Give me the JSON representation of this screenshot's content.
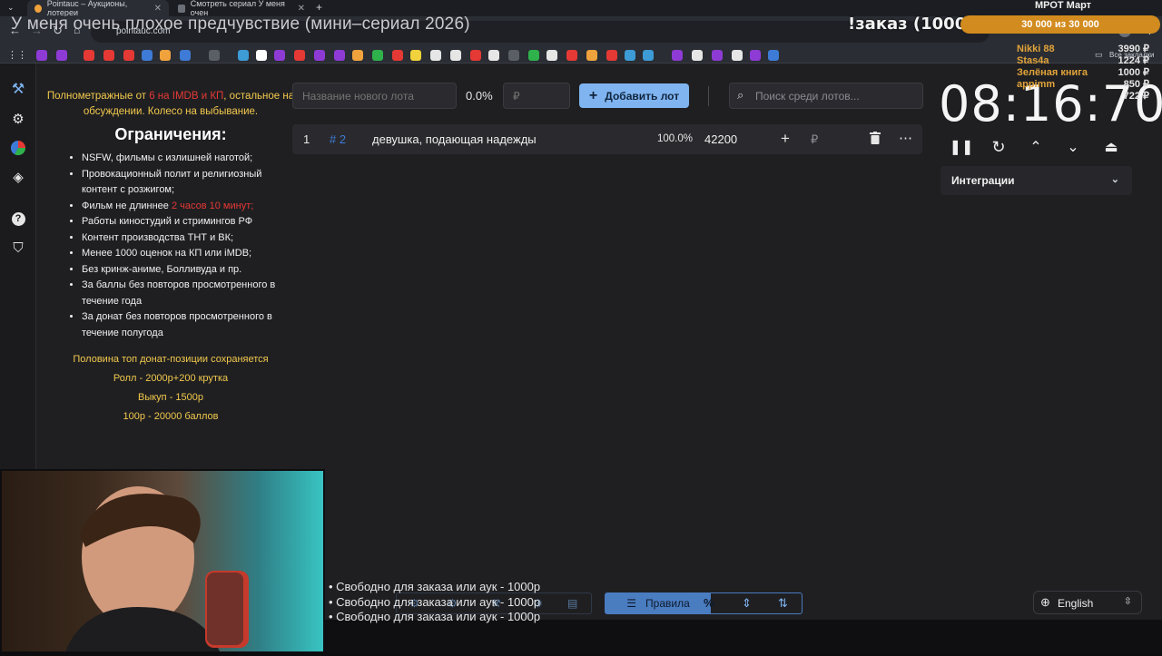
{
  "browser": {
    "tabs": [
      {
        "label": "Pointauc – Аукционы, лотереи",
        "active": true
      },
      {
        "label": "Смотреть сериал У меня очен",
        "active": false
      }
    ],
    "url": "pointauc.com",
    "all_bookmarks_label": "Все закладки"
  },
  "overlay": {
    "stream_title": "У меня очень плохое предчувствие (мини–сериал 2026)",
    "order_label": "!заказ (1000р)",
    "goal_title": "МРОТ Март",
    "goal_progress": "30 000  из 30 000",
    "goal_fraction": 1.0,
    "donors": [
      {
        "name": "Nikki 88",
        "amount": "3990 ₽"
      },
      {
        "name": "Stas4a",
        "amount": "1224 ₽"
      },
      {
        "name": "Зелёная книга",
        "amount": "1000 ₽"
      },
      {
        "name": "appimm",
        "amount": "850 ₽"
      },
      {
        "name": "",
        "amount": "722 ₽"
      }
    ],
    "ticker_lines": [
      "• Свободно для заказа или аук - 1000р",
      "• Свободно для заказа или аук - 1000р",
      "• Свободно для заказа или аук - 1000р"
    ]
  },
  "rules": {
    "top_line_prefix": "Полнометражные от ",
    "top_line_red": "6 на IMDB и КП",
    "top_line_suffix": ", остальное на обсуждении. Колесо на выбывание.",
    "heading": "Ограничения:",
    "items": [
      {
        "text": "NSFW, фильмы с излишней наготой;"
      },
      {
        "text": "Провокационный полит и религиозный контент с розжигом;"
      },
      {
        "text": "Фильм не длиннее ",
        "red": "2 часов 10 минут;"
      },
      {
        "text": "Работы киностудий и стримингов РФ"
      },
      {
        "text": "Контент производства ТНТ и ВК;"
      },
      {
        "text": "Менее 1000 оценок на КП или iMDB;"
      },
      {
        "text": "Без кринж-аниме, Болливуда и пр."
      },
      {
        "text": "За баллы без повторов просмотренного в течение года"
      },
      {
        "text": "За донат без повторов просмотренного в течение полугода"
      }
    ],
    "footer": [
      "Половина топ донат-позиции сохраняется",
      "Ролл - 2000р+200 крутка",
      "Выкуп - 1500р",
      "100р - 20000 баллов"
    ]
  },
  "lot_form": {
    "name_placeholder": "Название нового лота",
    "percent": "0.0%",
    "amount_placeholder": "₽",
    "add_button": "Добавить лот",
    "search_placeholder": "Поиск среди лотов..."
  },
  "lots": [
    {
      "index": "1",
      "id": "# 2",
      "name": "девушка, подающая надежды",
      "percent": "100.0%",
      "amount": "42200"
    }
  ],
  "timer": {
    "value": "08:16:70"
  },
  "integrations_label": "Интеграции",
  "bottom_toolbar": {
    "rules_label": "Правила",
    "percent_icon": "%"
  },
  "language": "English",
  "colors": {
    "accent": "#7fb4f0",
    "gold": "#f2c94c",
    "red": "#e53935",
    "goal": "#d28b1e"
  }
}
